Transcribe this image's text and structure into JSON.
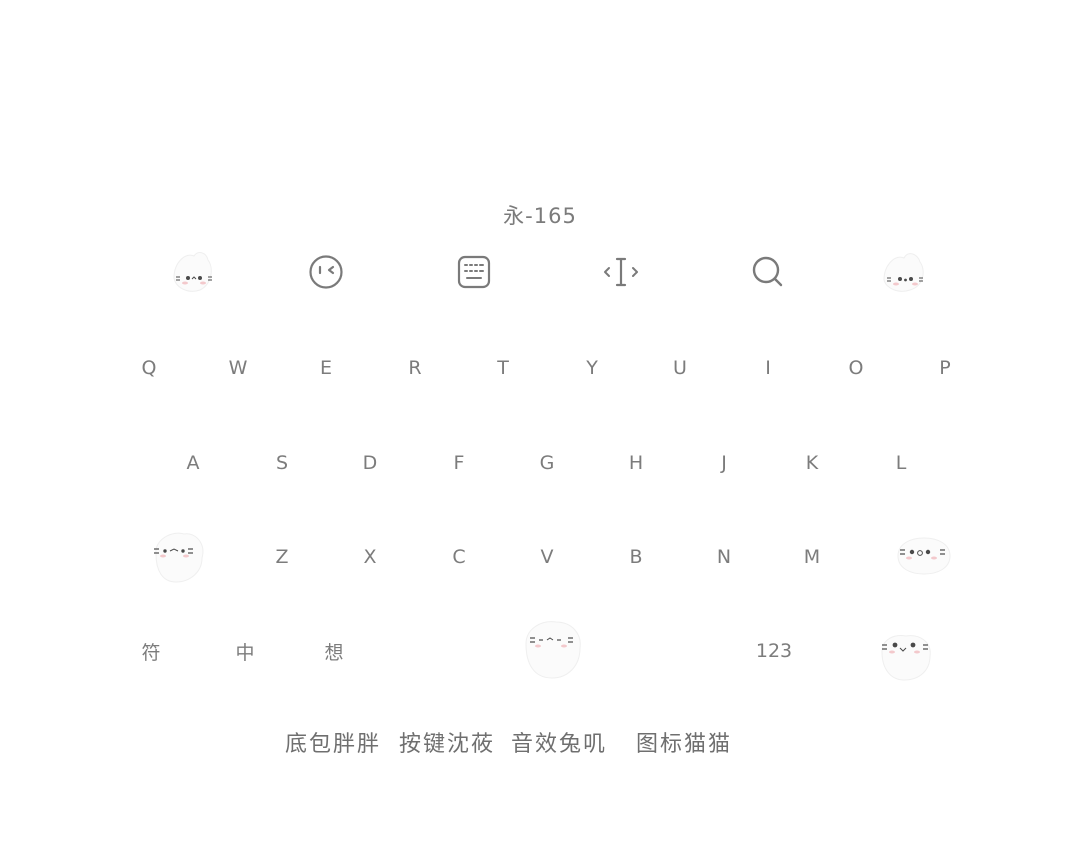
{
  "header": {
    "title": "永-165"
  },
  "toolbar": {
    "items": [
      {
        "icon": "cat-face-icon"
      },
      {
        "icon": "emoji-face-icon"
      },
      {
        "icon": "keyboard-icon"
      },
      {
        "icon": "cursor-move-icon"
      },
      {
        "icon": "search-icon"
      },
      {
        "icon": "cat-face-icon"
      }
    ]
  },
  "keyboard": {
    "row1": [
      "Q",
      "W",
      "E",
      "R",
      "T",
      "Y",
      "U",
      "I",
      "O",
      "P"
    ],
    "row2": [
      "A",
      "S",
      "D",
      "F",
      "G",
      "H",
      "J",
      "K",
      "L"
    ],
    "row3": [
      "Z",
      "X",
      "C",
      "V",
      "B",
      "N",
      "M"
    ],
    "row4": {
      "symbol": "符",
      "chinese": "中",
      "think": "想",
      "numbers": "123"
    }
  },
  "footer": {
    "items": [
      "底包胖胖",
      "按键沈莜",
      "音效兔叽",
      "图标猫猫"
    ]
  },
  "colors": {
    "text": "#7a7a7a",
    "background": "#ffffff",
    "cat_blush": "#f3c9cc",
    "cat_eye": "#4a4a4a"
  }
}
